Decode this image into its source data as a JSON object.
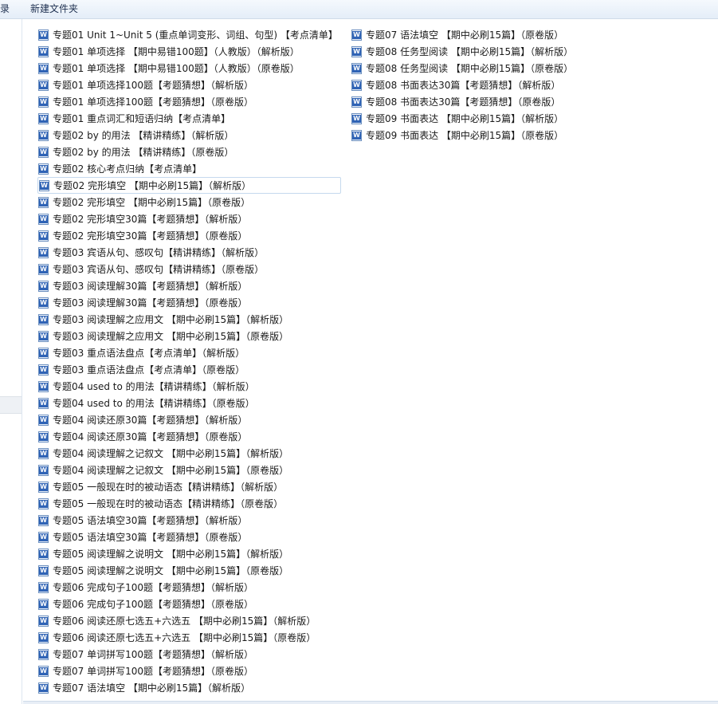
{
  "toolbar": {
    "left_label": "录",
    "new_folder": "新建文件夹"
  },
  "files": {
    "column1": [
      "专题01 Unit 1~Unit 5 (重点单词变形、词组、句型) 【考点清单】",
      "专题01 单项选择 【期中易错100题】（人教版）（解析版）",
      "专题01 单项选择 【期中易错100题】（人教版）（原卷版）",
      "专题01 单项选择100题【考题猜想】（解析版）",
      "专题01 单项选择100题【考题猜想】（原卷版）",
      "专题01 重点词汇和短语归纳【考点清单】",
      "专题02  by 的用法 【精讲精练】（解析版）",
      "专题02  by 的用法 【精讲精练】（原卷版）",
      "专题02 核心考点归纳【考点清单】",
      "专题02 完形填空 【期中必刷15篇】（解析版）",
      "专题02 完形填空 【期中必刷15篇】（原卷版）",
      "专题02 完形填空30篇【考题猜想】（解析版）",
      "专题02 完形填空30篇【考题猜想】（原卷版）",
      "专题03  宾语从句、感叹句【精讲精练】（解析版）",
      "专题03  宾语从句、感叹句【精讲精练】（原卷版）",
      "专题03 阅读理解30篇【考题猜想】（解析版）",
      "专题03 阅读理解30篇【考题猜想】（原卷版）",
      "专题03 阅读理解之应用文 【期中必刷15篇】（解析版）",
      "专题03 阅读理解之应用文 【期中必刷15篇】（原卷版）",
      "专题03 重点语法盘点【考点清单】（解析版）",
      "专题03 重点语法盘点【考点清单】（原卷版）",
      "专题04 used to 的用法【精讲精练】（解析版）",
      "专题04 used to 的用法【精讲精练】（原卷版）",
      "专题04 阅读还原30篇【考题猜想】（解析版）",
      "专题04 阅读还原30篇【考题猜想】（原卷版）",
      "专题04 阅读理解之记叙文 【期中必刷15篇】（解析版）",
      "专题04 阅读理解之记叙文 【期中必刷15篇】（原卷版）",
      "专题05 一般现在时的被动语态【精讲精练】（解析版）",
      "专题05 一般现在时的被动语态【精讲精练】（原卷版）",
      "专题05 语法填空30篇【考题猜想】（解析版）",
      "专题05 语法填空30篇【考题猜想】（原卷版）",
      "专题05 阅读理解之说明文 【期中必刷15篇】（解析版）",
      "专题05 阅读理解之说明文 【期中必刷15篇】（原卷版）",
      "专题06 完成句子100题【考题猜想】（解析版）",
      "专题06 完成句子100题【考题猜想】（原卷版）",
      "专题06 阅读还原七选五+六选五 【期中必刷15篇】（解析版）",
      "专题06 阅读还原七选五+六选五 【期中必刷15篇】（原卷版）",
      "专题07 单词拼写100题【考题猜想】（解析版）",
      "专题07 单词拼写100题【考题猜想】（原卷版）",
      "专题07 语法填空 【期中必刷15篇】（解析版）"
    ],
    "column2": [
      "专题07 语法填空 【期中必刷15篇】（原卷版）",
      "专题08 任务型阅读 【期中必刷15篇】（解析版）",
      "专题08 任务型阅读 【期中必刷15篇】（原卷版）",
      "专题08 书面表达30篇【考题猜想】（解析版）",
      "专题08 书面表达30篇【考题猜想】（原卷版）",
      "专题09 书面表达 【期中必刷15篇】（解析版）",
      "专题09 书面表达 【期中必刷15篇】（原卷版）"
    ]
  },
  "colors": {
    "toolbar_bg": "#e4edf8",
    "icon_blue": "#2f63b5",
    "text": "#1a1a1a"
  },
  "icons": {
    "file": "word-document-icon"
  }
}
